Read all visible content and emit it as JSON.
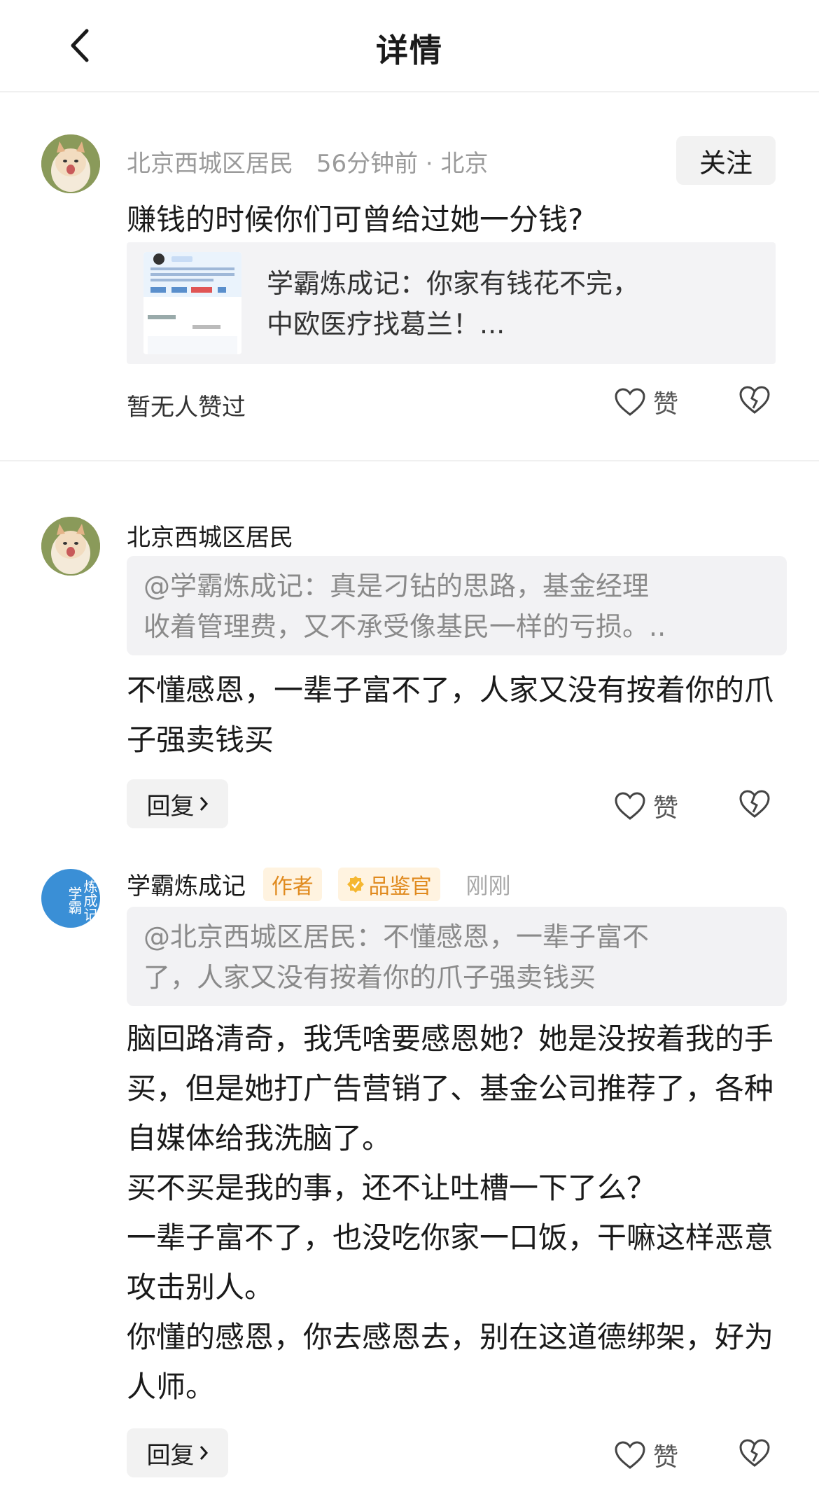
{
  "header": {
    "title": "详情"
  },
  "post": {
    "author": "北京西城区居民",
    "time": "56分钟前 · 北京",
    "follow_label": "关注",
    "text": "赚钱的时候你们可曾给过她一分钱?",
    "share": {
      "line1": "学霸炼成记：你家有钱花不完，",
      "line2": "中欧医疗找葛兰！..."
    },
    "likes_label": "暂无人赞过",
    "like_label": "赞"
  },
  "comments": [
    {
      "author": "北京西城区居民",
      "quote_line1": "@学霸炼成记：真是刁钻的思路，基金经理",
      "quote_line2": "收着管理费，又不承受像基民一样的亏损。..",
      "text": "不懂感恩，一辈子富不了，人家又没有按着你的爪子强卖钱买",
      "reply_label": "回复",
      "like_label": "赞"
    },
    {
      "author": "学霸炼成记",
      "author_badge": "作者",
      "role_badge": "品鉴官",
      "time": "刚刚",
      "avatar_text": "炼成记学霸",
      "quote_line1": "@北京西城区居民：不懂感恩，一辈子富不",
      "quote_line2": "了，人家又没有按着你的爪子强卖钱买",
      "text": "脑回路清奇，我凭啥要感恩她？她是没按着我的手买，但是她打广告营销了、基金公司推荐了，各种自媒体给我洗脑了。\n买不买是我的事，还不让吐槽一下了么？\n一辈子富不了，也没吃你家一口饭，干嘛这样恶意攻击别人。\n你懂的感恩，你去感恩去，别在这道德绑架，好为人师。",
      "reply_label": "回复",
      "like_label": "赞"
    }
  ],
  "colors": {
    "accent_orange": "#e08a1e",
    "avatar_blue": "#3a8fd6"
  }
}
